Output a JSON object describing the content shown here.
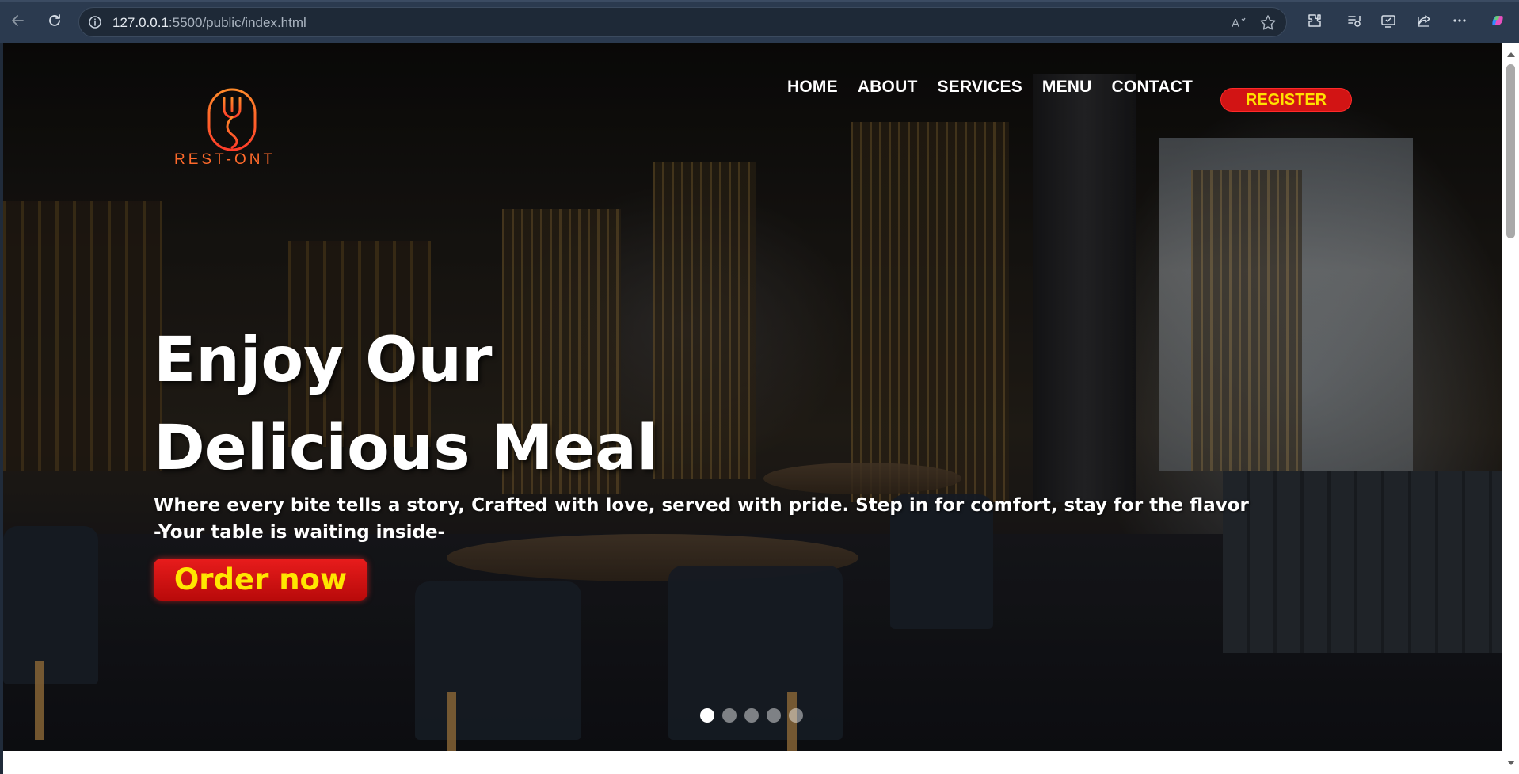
{
  "browser": {
    "url_host": "127.0.0.1",
    "url_rest": ":5500/public/index.html",
    "reader_icon_label": "A"
  },
  "site": {
    "logo_text": "REST-ONT",
    "nav": {
      "home": "HOME",
      "about": "ABOUT",
      "services": "SERVICES",
      "menu": "MENU",
      "contact": "CONTACT"
    },
    "register_label": "REGISTER"
  },
  "hero": {
    "heading_line1": "Enjoy Our",
    "heading_line2": "Delicious Meal",
    "tagline": "Where every bite tells a story, Crafted with love, served with pride. Step in for comfort, stay for the flavor",
    "tagline2": "-Your table is waiting inside-",
    "order_label": "Order now",
    "slides_count": 5,
    "active_slide": 1
  },
  "colors": {
    "brand_orange": "#ff6a2b",
    "button_red": "#d21414",
    "button_text_yellow": "#ffe100"
  },
  "icons": [
    "back-arrow-icon",
    "refresh-icon",
    "info-icon",
    "read-aloud-icon",
    "favorite-star-icon",
    "extensions-icon",
    "collections-icon",
    "screenshot-icon",
    "share-icon",
    "more-icon",
    "copilot-icon",
    "fork-logo-icon"
  ]
}
